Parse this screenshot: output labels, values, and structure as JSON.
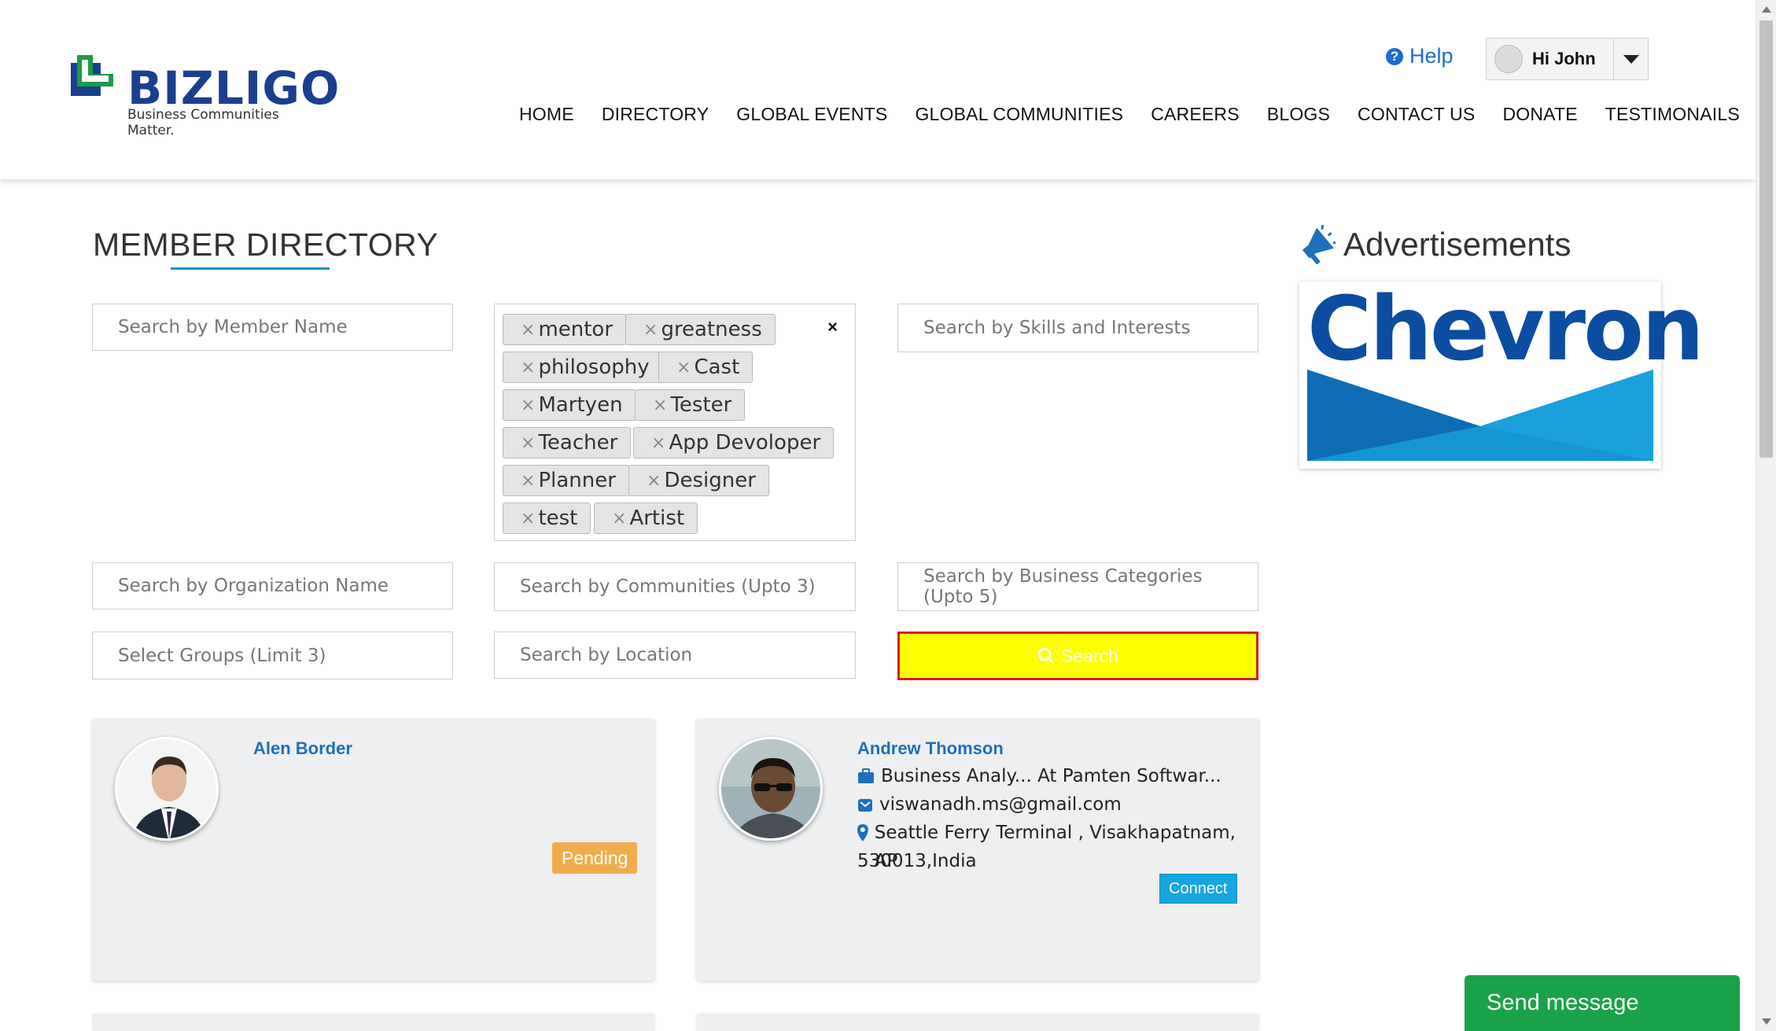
{
  "header": {
    "logo_text": "BIZLIGO",
    "logo_tagline": "Business Communities Matter.",
    "help_label": "Help",
    "user_greeting": "Hi John",
    "nav": [
      "HOME",
      "DIRECTORY",
      "GLOBAL EVENTS",
      "GLOBAL COMMUNITIES",
      "CAREERS",
      "BLOGS",
      "CONTACT US",
      "DONATE",
      "TESTIMONAILS"
    ]
  },
  "page": {
    "title": "MEMBER DIRECTORY"
  },
  "filters": {
    "member_name_placeholder": "Search by Member Name",
    "skills_placeholder": "Search by Skills and Interests",
    "organization_placeholder": "Search by Organization Name",
    "communities_placeholder": "Search by Communities (Upto 3)",
    "business_categories_placeholder": "Search by Business Categories (Upto 5)",
    "groups_placeholder": "Select Groups (Limit 3)",
    "location_placeholder": "Search by Location",
    "search_button": "Search",
    "tag_clear": "×",
    "tags": [
      "mentor",
      "greatness",
      "philosophy",
      "Cast",
      "Martyen",
      "Tester",
      "Teacher",
      "App Devoloper",
      "Planner",
      "Designer",
      "test",
      "Artist"
    ]
  },
  "members": [
    {
      "name": "Alen Border",
      "status": "Pending"
    },
    {
      "name": "Andrew Thomson",
      "job": "Business Analy... At Pamten Softwar...",
      "email": "viswanadh.ms@gmail.com",
      "location_line1": "Seattle Ferry Terminal , Visakhapatnam, AP",
      "location_line2": "530013,India",
      "action": "Connect"
    }
  ],
  "ads": {
    "title": "Advertisements",
    "brand": "Chevron"
  },
  "chat": {
    "label": "Send message"
  },
  "icons": {
    "help": "question-circle-icon",
    "caret": "caret-down-icon",
    "search": "search-icon",
    "job": "briefcase-icon",
    "email": "envelope-icon",
    "location": "map-marker-icon",
    "ads": "megaphone-icon"
  },
  "colors": {
    "brand_blue": "#1b3f8f",
    "logo_green": "#1e9a47",
    "link_blue": "#1f6fba",
    "search_bg": "#ffff00",
    "search_border": "#d42020",
    "pending": "#f0ad4e",
    "connect": "#16a6e0",
    "chat": "#1aa249"
  }
}
